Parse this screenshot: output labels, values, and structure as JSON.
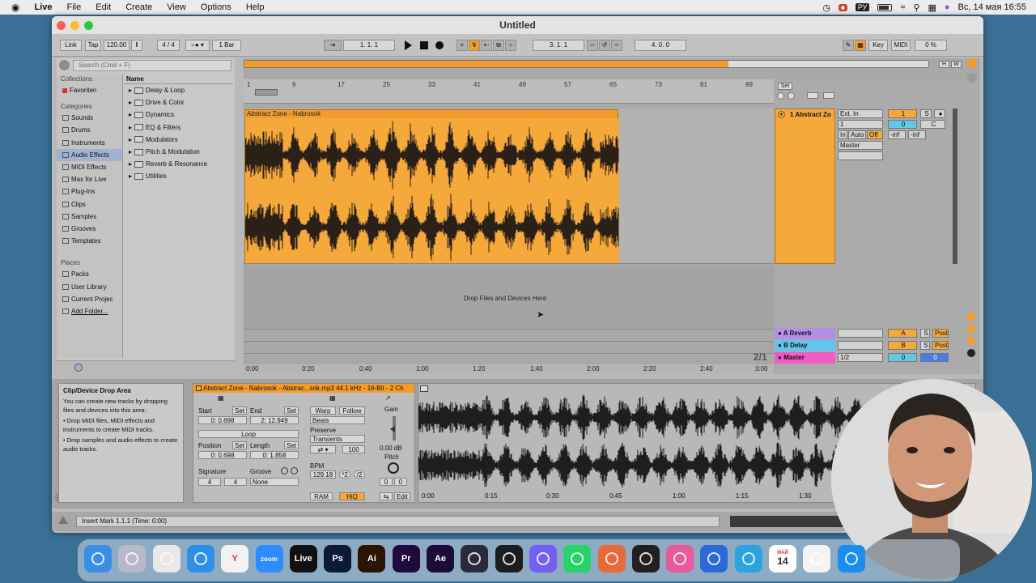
{
  "menubar": {
    "apple": "",
    "items": [
      "Live",
      "File",
      "Edit",
      "Create",
      "View",
      "Options",
      "Help"
    ],
    "input_lang": "РУ",
    "datetime": "Вс, 14 мая  16:55"
  },
  "window": {
    "title": "Untitled"
  },
  "control_bar": {
    "link": "Link",
    "tap": "Tap",
    "tempo": "120.00",
    "signature": "4 / 4",
    "quantize": "1 Bar",
    "position": "1.   1.   1",
    "loop_start": "3.   1.   1",
    "loop_length": "4.   0.   0",
    "key": "Key",
    "midi": "MIDI",
    "cpu": "0 %"
  },
  "browser": {
    "search_placeholder": "Search (Cmd + F)",
    "collections_header": "Collections",
    "favorites": "Favoriten",
    "categories_header": "Categories",
    "categories": [
      "Sounds",
      "Drums",
      "Instruments",
      "Audio Effects",
      "MIDI Effects",
      "Max for Live",
      "Plug-Ins",
      "Clips",
      "Samples",
      "Grooves",
      "Templates"
    ],
    "selected_category": "Audio Effects",
    "places_header": "Places",
    "places": [
      "Packs",
      "User Library",
      "Current Projec",
      "Add Folder..."
    ],
    "name_header": "Name",
    "folders": [
      "Delay & Loop",
      "Drive & Color",
      "Dynamics",
      "EQ & Filters",
      "Modulators",
      "Pitch & Modulation",
      "Reverb & Resonance",
      "Utilities"
    ]
  },
  "arrangement": {
    "set_label": "Set",
    "bar_numbers": [
      "1",
      "9",
      "17",
      "25",
      "33",
      "41",
      "49",
      "57",
      "65",
      "73",
      "81",
      "89"
    ],
    "clip_name": "Abstract Zone - Nabrosok",
    "drop_hint": "Drop Files and Devices Here",
    "times": [
      "0:00",
      "0:20",
      "0:40",
      "1:00",
      "1:20",
      "1:40",
      "2:00",
      "2:20",
      "2:40",
      "3:00"
    ],
    "zoom_ratio": "2/1"
  },
  "mixer": {
    "track1_name": "1 Abstract Zo",
    "input_type": "Ext. In",
    "input_channel": "1",
    "monitor": [
      "In",
      "Auto",
      "Off"
    ],
    "output": "Master",
    "track_number": "1",
    "solo": "S",
    "volume": "0",
    "pan": "C",
    "peak_left": "-inf",
    "peak_right": "-inf",
    "returns": [
      {
        "name": "A Reverb",
        "letter": "A",
        "solo": "S",
        "mode": "Post",
        "color": "#b58ee8"
      },
      {
        "name": "B Delay",
        "letter": "B",
        "solo": "S",
        "mode": "Post",
        "color": "#62c6ec"
      },
      {
        "name": "Master",
        "letter": "0",
        "solo": "",
        "mode": "0",
        "cue": "1/2",
        "color": "#f05bc4"
      }
    ]
  },
  "info_view": {
    "title": "Clip/Device Drop Area",
    "lines": [
      "You can create new tracks by dropping files and devices into this area:",
      "• Drop MIDI files, MIDI effects and instruments to create MIDI tracks.",
      "• Drop samples and audio effects to create audio tracks."
    ]
  },
  "clip_view": {
    "header": "Abstract Zone - Nabrosok - Abstrac...sok.mp3  44.1 kHz - 16-Bit - 2 Ch",
    "start_label": "Start",
    "end_label": "End",
    "set": "Set",
    "start_value": "0:  0.698",
    "end_value": "2: 12.949",
    "loop": "Loop",
    "position_label": "Position",
    "length_label": "Length",
    "position_value": "0:  0.698",
    "length_value": "0:  1.858",
    "signature_label": "Signature",
    "groove_label": "Groove",
    "sig_num": "4",
    "sig_den": "4",
    "groove_value": "None",
    "warp": "Warp",
    "follow": "Follow",
    "warp_mode": "Beats",
    "preserve_label": "Preserve",
    "preserve_value": "Transients",
    "loop_value": "100",
    "bpm_label": "BPM",
    "bpm_value": "129.18",
    "double": "*2",
    "half": "/2",
    "ram": "RAM",
    "hiq": "HiQ",
    "gain_label": "Gain",
    "gain_value": "0.00 dB",
    "pitch_label": "Pitch",
    "pitch_semi": "0",
    "pitch_cents": "0",
    "edit": "Edit",
    "sample_times": [
      "0:00",
      "0:15",
      "0:30",
      "0:45",
      "1:00",
      "1:15",
      "1:30"
    ]
  },
  "status_bar": {
    "text": "Insert Mark 1.1.1 (Time: 0:00)"
  },
  "dock": {
    "apps": [
      {
        "name": "finder",
        "label": "",
        "color": "#3a8ee6"
      },
      {
        "name": "launchpad",
        "label": "",
        "color": "#b8b8c8"
      },
      {
        "name": "chrome",
        "label": "",
        "color": "#e8e8e8"
      },
      {
        "name": "safari",
        "label": "",
        "color": "#2f8fe8"
      },
      {
        "name": "yandex",
        "label": "Y",
        "color": "#f2f2f2"
      },
      {
        "name": "zoom",
        "label": "zoom",
        "color": "#2d8cff"
      },
      {
        "name": "live",
        "label": "Live",
        "color": "#111111"
      },
      {
        "name": "photoshop",
        "label": "Ps",
        "color": "#0b1b33"
      },
      {
        "name": "illustrator",
        "label": "Ai",
        "color": "#2b1400"
      },
      {
        "name": "premiere",
        "label": "Pr",
        "color": "#1e0a3c"
      },
      {
        "name": "after-effects",
        "label": "Ae",
        "color": "#1a0b38"
      },
      {
        "name": "davinci",
        "label": "",
        "color": "#2a2a3a"
      },
      {
        "name": "obs",
        "label": "",
        "color": "#1d1d1d"
      },
      {
        "name": "viber",
        "label": "",
        "color": "#7360f2"
      },
      {
        "name": "whatsapp",
        "label": "",
        "color": "#25d366"
      },
      {
        "name": "rocket-typist",
        "label": "",
        "color": "#e8693a"
      },
      {
        "name": "activity-monitor",
        "label": "",
        "color": "#202020"
      },
      {
        "name": "cleanmymac",
        "label": "",
        "color": "#e85a9a"
      },
      {
        "name": "claquette",
        "label": "",
        "color": "#2a6ad8"
      },
      {
        "name": "telegram",
        "label": "",
        "color": "#2aa3e0"
      },
      {
        "name": "calendar",
        "label": "14",
        "month": "МАЙ",
        "color": "#ffffff"
      },
      {
        "name": "textedit",
        "label": "",
        "color": "#f3f3f3"
      },
      {
        "name": "app-store",
        "label": "",
        "color": "#1a8df0"
      }
    ]
  },
  "colors": {
    "clip_orange": "#f5a93a",
    "clip_header": "#f39c2b",
    "selection_blue": "#9fb3cc",
    "return_a": "#b58ee8",
    "return_b": "#62c6ec",
    "master": "#f05bc4"
  }
}
